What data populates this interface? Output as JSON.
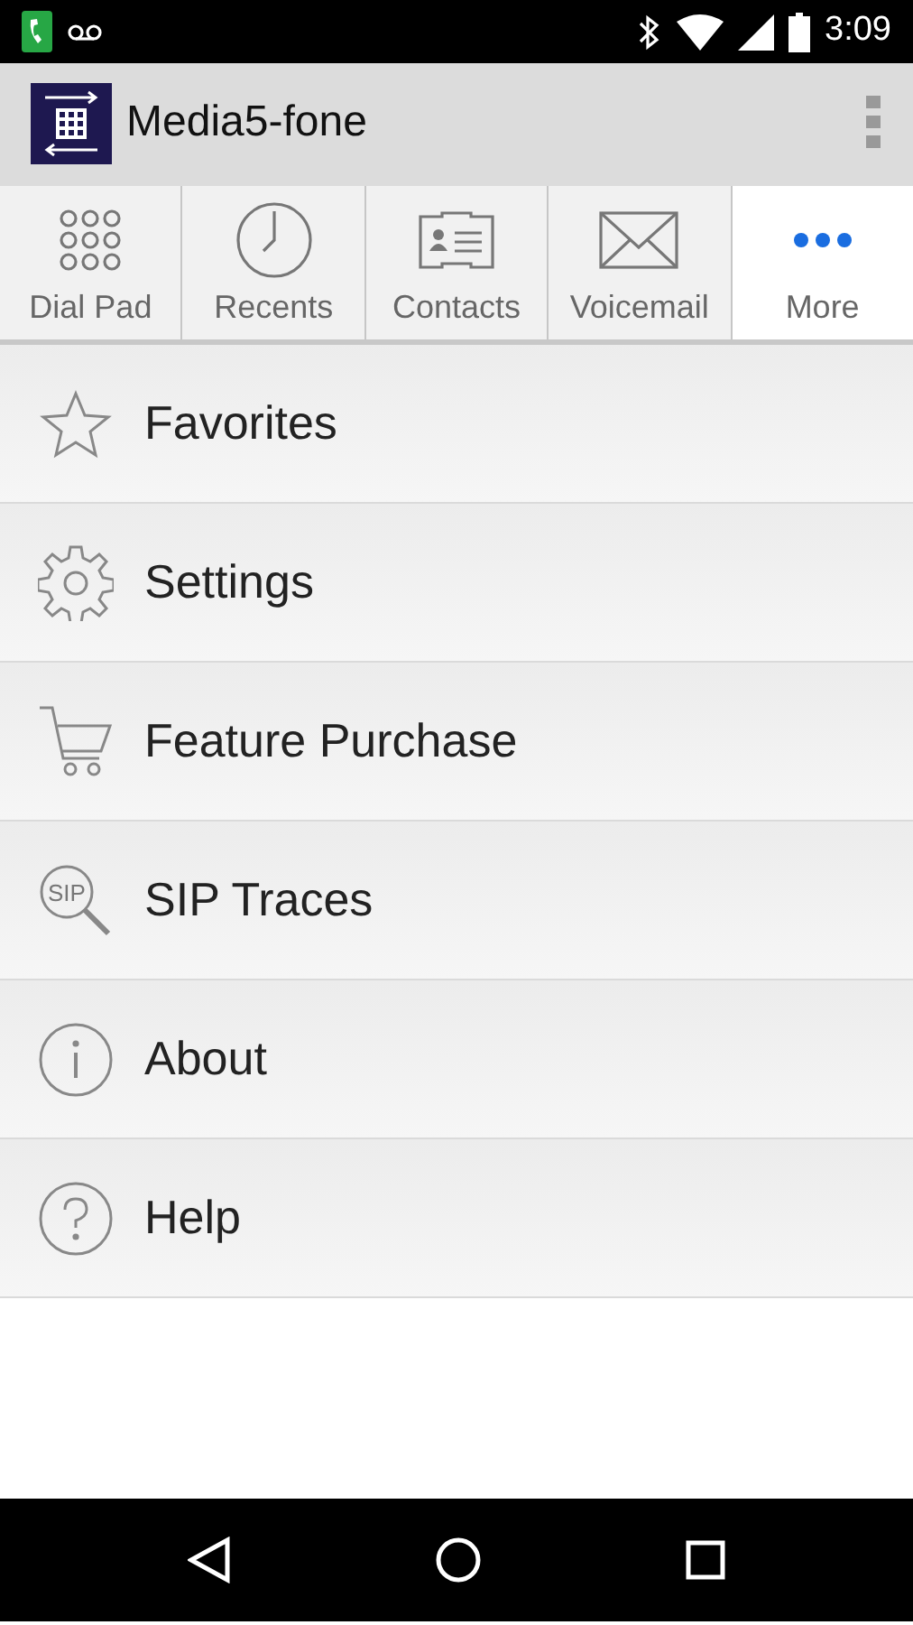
{
  "status_bar": {
    "time": "3:09"
  },
  "app_bar": {
    "title": "Media5-fone"
  },
  "tabs": [
    {
      "label": "Dial Pad",
      "kind": "dialpad",
      "selected": false
    },
    {
      "label": "Recents",
      "kind": "clock",
      "selected": false
    },
    {
      "label": "Contacts",
      "kind": "card",
      "selected": false
    },
    {
      "label": "Voicemail",
      "kind": "envelope",
      "selected": false
    },
    {
      "label": "More",
      "kind": "dots",
      "selected": true
    }
  ],
  "menu": [
    {
      "label": "Favorites",
      "kind": "star"
    },
    {
      "label": "Settings",
      "kind": "gear"
    },
    {
      "label": "Feature Purchase",
      "kind": "cart"
    },
    {
      "label": "SIP Traces",
      "kind": "sip",
      "icon_text": "SIP"
    },
    {
      "label": "About",
      "kind": "info"
    },
    {
      "label": "Help",
      "kind": "help"
    }
  ]
}
